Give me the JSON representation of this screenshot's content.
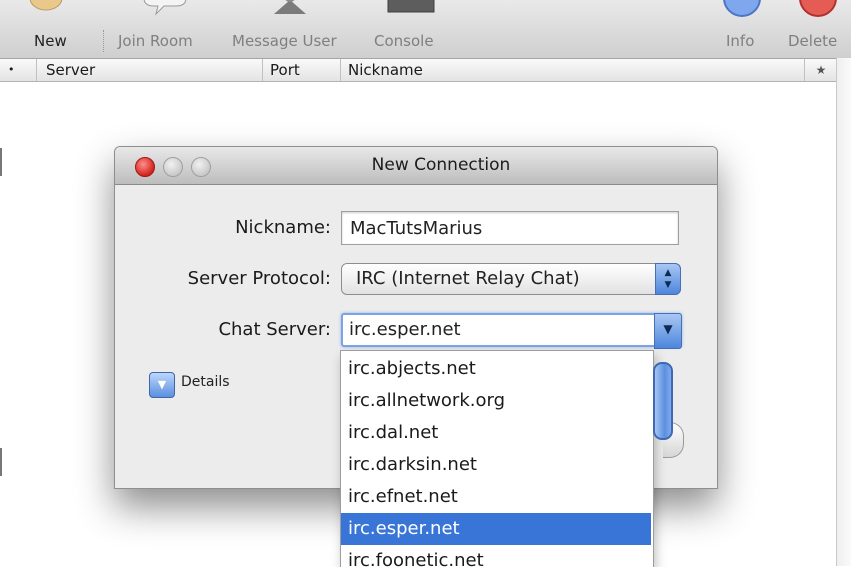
{
  "toolbar": {
    "new_label": "New",
    "join_room_label": "Join Room",
    "message_user_label": "Message User",
    "console_label": "Console",
    "info_label": "Info",
    "delete_label": "Delete"
  },
  "table": {
    "columns": [
      "•",
      "Server",
      "Port",
      "Nickname",
      "★"
    ]
  },
  "dialog": {
    "title": "New Connection",
    "nickname_label": "Nickname:",
    "nickname_value": "MacTutsMarius",
    "protocol_label": "Server Protocol:",
    "protocol_value": "IRC (Internet Relay Chat)",
    "server_label": "Chat Server:",
    "server_value": "irc.esper.net",
    "details_label": "Details"
  },
  "server_list": {
    "items": [
      "irc.abjects.net",
      "irc.allnetwork.org",
      "irc.dal.net",
      "irc.darksin.net",
      "irc.efnet.net",
      "irc.esper.net",
      "irc.foonetic.net"
    ],
    "selected": "irc.esper.net"
  },
  "colors": {
    "selection": "#3875d7",
    "close_button": "#d2231c",
    "aqua_blue": "#4d86dc"
  }
}
